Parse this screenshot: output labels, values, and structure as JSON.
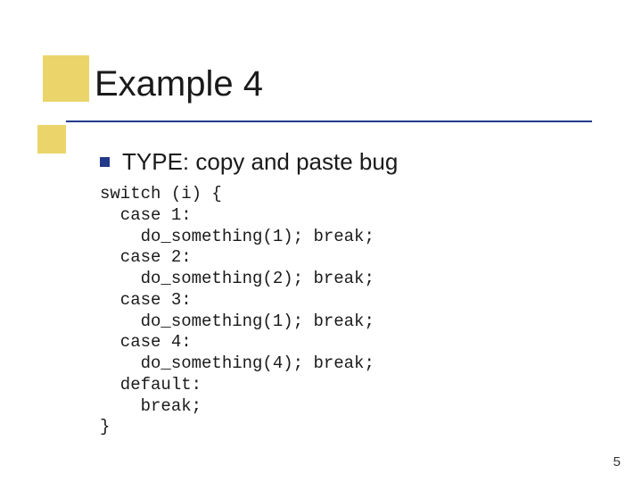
{
  "title": "Example 4",
  "subtitle": "TYPE: copy and paste bug",
  "code": "switch (i) {\n  case 1:\n    do_something(1); break;\n  case 2:\n    do_something(2); break;\n  case 3:\n    do_something(1); break;\n  case 4:\n    do_something(4); break;\n  default:\n    break;\n}",
  "page_number": "5"
}
